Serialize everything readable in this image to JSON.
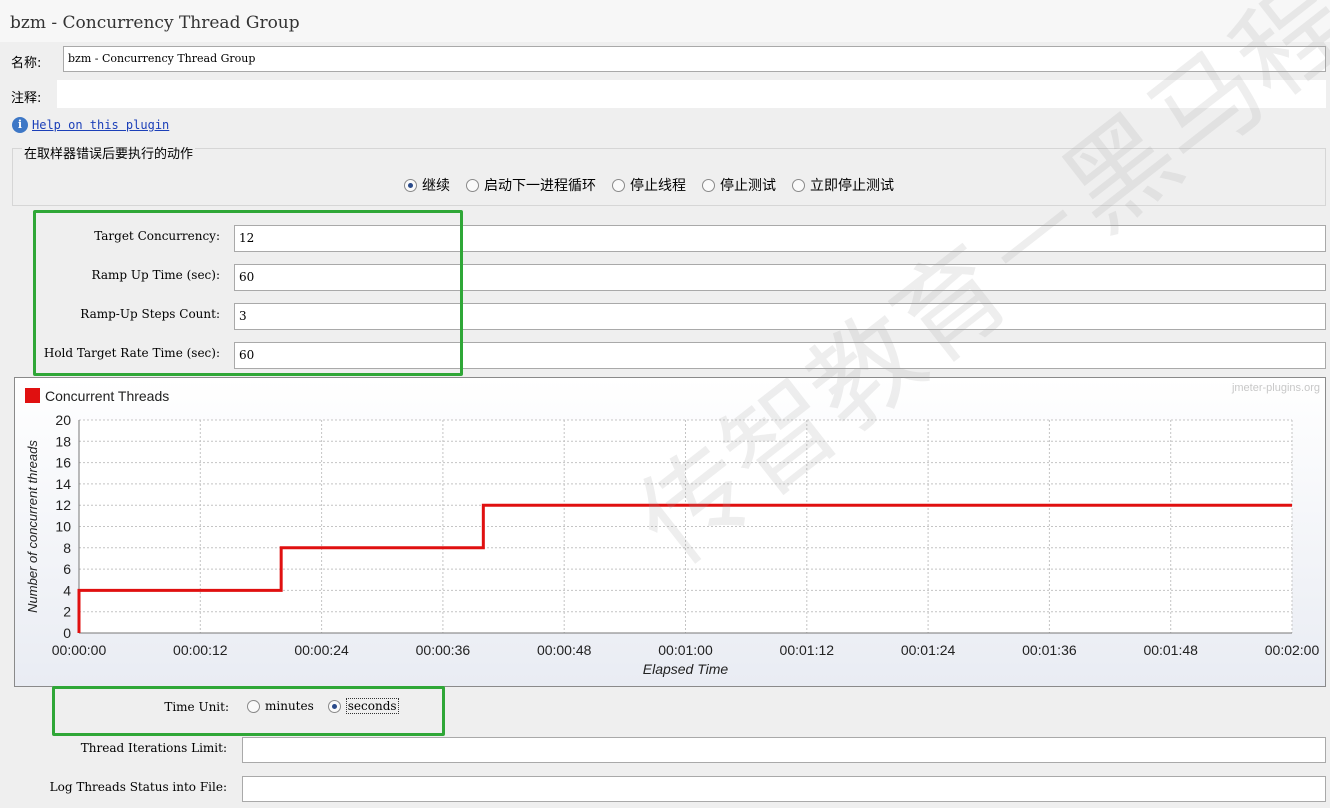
{
  "window": {
    "title": "bzm - Concurrency Thread Group"
  },
  "name_field": {
    "label": "名称:",
    "value": "bzm - Concurrency Thread Group"
  },
  "comment_field": {
    "label": "注释:",
    "value": ""
  },
  "help_link": {
    "label": "Help on this plugin",
    "icon": "info-icon"
  },
  "sampler_error": {
    "title": "在取样器错误后要执行的动作",
    "options": [
      "继续",
      "启动下一进程循环",
      "停止线程",
      "停止测试",
      "立即停止测试"
    ],
    "selected": 0
  },
  "params": [
    {
      "label": "Target Concurrency:",
      "value": "12"
    },
    {
      "label": "Ramp Up Time (sec):",
      "value": "60"
    },
    {
      "label": "Ramp-Up Steps Count:",
      "value": "3"
    },
    {
      "label": "Hold Target Rate Time (sec):",
      "value": "60"
    }
  ],
  "chart_data": {
    "type": "line",
    "watermark": "jmeter-plugins.org",
    "legend": [
      "Concurrent Threads"
    ],
    "legend_placement": "top-left",
    "xlabel": "Elapsed Time",
    "ylabel": "Number of concurrent threads",
    "x_ticks": [
      "00:00:00",
      "00:00:12",
      "00:00:24",
      "00:00:36",
      "00:00:48",
      "00:01:00",
      "00:01:12",
      "00:01:24",
      "00:01:36",
      "00:01:48",
      "00:02:00"
    ],
    "y_ticks": [
      0,
      2,
      4,
      6,
      8,
      10,
      12,
      14,
      16,
      18,
      20
    ],
    "xlim": [
      0,
      120
    ],
    "ylim": [
      0,
      20
    ],
    "grid": true,
    "color": "#e01010",
    "series": [
      {
        "name": "Concurrent Threads",
        "x": [
          0,
          0,
          20,
          20,
          40,
          40,
          120
        ],
        "y": [
          0,
          4,
          4,
          8,
          8,
          12,
          12
        ]
      }
    ]
  },
  "time_unit": {
    "label": "Time Unit:",
    "options": [
      "minutes",
      "seconds"
    ],
    "selected": 1
  },
  "iterations": {
    "label": "Thread Iterations Limit:",
    "value": ""
  },
  "log_file": {
    "label": "Log Threads Status into File:",
    "value": ""
  },
  "bg_watermark": "传智教育－黑马程"
}
